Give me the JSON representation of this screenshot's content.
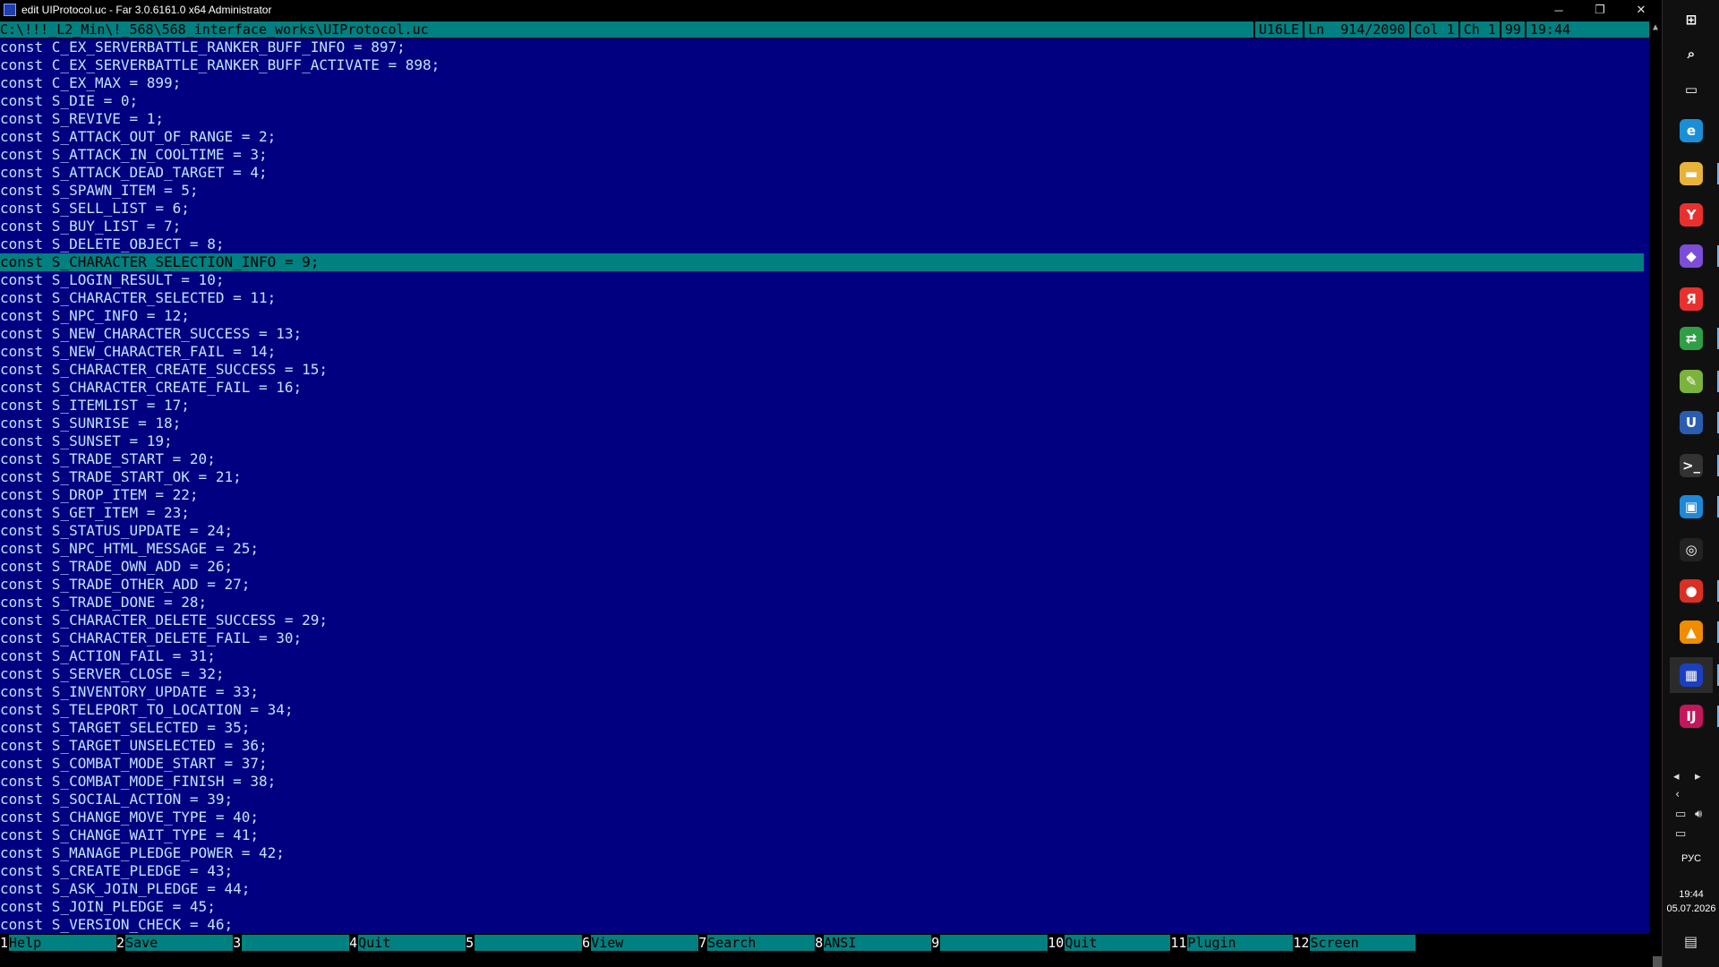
{
  "window": {
    "title": "edit UIProtocol.uc - Far 3.0.6161.0 x64 Administrator",
    "minimize_glyph": "─",
    "restore_glyph": "❐",
    "close_glyph": "✕"
  },
  "status": {
    "path": "C:\\!!!_L2_Min\\!_568\\568_interface_works\\UIProtocol.uc",
    "encoding": "U16LE",
    "line": "Ln  914/2090",
    "col": "Col 1",
    "char": "Ch 1",
    "code": "99",
    "clock": "19:44"
  },
  "editor": {
    "current_line_index": 12,
    "lines": [
      "const C_EX_SERVERBATTLE_RANKER_BUFF_INFO = 897;",
      "const C_EX_SERVERBATTLE_RANKER_BUFF_ACTIVATE = 898;",
      "const C_EX_MAX = 899;",
      "const S_DIE = 0;",
      "const S_REVIVE = 1;",
      "const S_ATTACK_OUT_OF_RANGE = 2;",
      "const S_ATTACK_IN_COOLTIME = 3;",
      "const S_ATTACK_DEAD_TARGET = 4;",
      "const S_SPAWN_ITEM = 5;",
      "const S_SELL_LIST = 6;",
      "const S_BUY_LIST = 7;",
      "const S_DELETE_OBJECT = 8;",
      "const S_CHARACTER_SELECTION_INFO = 9;",
      "const S_LOGIN_RESULT = 10;",
      "const S_CHARACTER_SELECTED = 11;",
      "const S_NPC_INFO = 12;",
      "const S_NEW_CHARACTER_SUCCESS = 13;",
      "const S_NEW_CHARACTER_FAIL = 14;",
      "const S_CHARACTER_CREATE_SUCCESS = 15;",
      "const S_CHARACTER_CREATE_FAIL = 16;",
      "const S_ITEMLIST = 17;",
      "const S_SUNRISE = 18;",
      "const S_SUNSET = 19;",
      "const S_TRADE_START = 20;",
      "const S_TRADE_START_OK = 21;",
      "const S_DROP_ITEM = 22;",
      "const S_GET_ITEM = 23;",
      "const S_STATUS_UPDATE = 24;",
      "const S_NPC_HTML_MESSAGE = 25;",
      "const S_TRADE_OWN_ADD = 26;",
      "const S_TRADE_OTHER_ADD = 27;",
      "const S_TRADE_DONE = 28;",
      "const S_CHARACTER_DELETE_SUCCESS = 29;",
      "const S_CHARACTER_DELETE_FAIL = 30;",
      "const S_ACTION_FAIL = 31;",
      "const S_SERVER_CLOSE = 32;",
      "const S_INVENTORY_UPDATE = 33;",
      "const S_TELEPORT_TO_LOCATION = 34;",
      "const S_TARGET_SELECTED = 35;",
      "const S_TARGET_UNSELECTED = 36;",
      "const S_COMBAT_MODE_START = 37;",
      "const S_COMBAT_MODE_FINISH = 38;",
      "const S_SOCIAL_ACTION = 39;",
      "const S_CHANGE_MOVE_TYPE = 40;",
      "const S_CHANGE_WAIT_TYPE = 41;",
      "const S_MANAGE_PLEDGE_POWER = 42;",
      "const S_CREATE_PLEDGE = 43;",
      "const S_ASK_JOIN_PLEDGE = 44;",
      "const S_JOIN_PLEDGE = 45;",
      "const S_VERSION_CHECK = 46;"
    ]
  },
  "keybar": [
    {
      "num": "1",
      "label": "Help"
    },
    {
      "num": "2",
      "label": "Save"
    },
    {
      "num": "3",
      "label": ""
    },
    {
      "num": "4",
      "label": "Quit"
    },
    {
      "num": "5",
      "label": ""
    },
    {
      "num": "6",
      "label": "View"
    },
    {
      "num": "7",
      "label": "Search"
    },
    {
      "num": "8",
      "label": "ANSI"
    },
    {
      "num": "9",
      "label": ""
    },
    {
      "num": "10",
      "label": "Quit"
    },
    {
      "num": "11",
      "label": "Plugin"
    },
    {
      "num": "12",
      "label": "Screen"
    }
  ],
  "taskbar": {
    "apps": [
      {
        "name": "start-icon",
        "glyph": "⊞",
        "color": "#101010"
      },
      {
        "name": "search-icon",
        "glyph": "⌕",
        "color": "#101010"
      },
      {
        "name": "task-view-icon",
        "glyph": "▭",
        "color": "#101010"
      },
      {
        "name": "edge-icon",
        "glyph": "e",
        "color": "#1b8fd6"
      },
      {
        "name": "file-explorer-icon",
        "glyph": "▬",
        "color": "#e8b339"
      },
      {
        "name": "yandex-browser-icon",
        "glyph": "Y",
        "color": "#e8312f"
      },
      {
        "name": "obsidian-icon",
        "glyph": "◆",
        "color": "#7c4dd6"
      },
      {
        "name": "yandex-icon",
        "glyph": "Я",
        "color": "#e8312f"
      },
      {
        "name": "translator-icon",
        "glyph": "⇄",
        "color": "#2f9e44"
      },
      {
        "name": "notepad-icon",
        "glyph": "✎",
        "color": "#7bb33c"
      },
      {
        "name": "unreal-icon",
        "glyph": "U",
        "color": "#2a5db0"
      },
      {
        "name": "terminal-icon",
        "glyph": ">_",
        "color": "#333333"
      },
      {
        "name": "remote-desktop-icon",
        "glyph": "▣",
        "color": "#1e88d6"
      },
      {
        "name": "steam-icon",
        "glyph": "◎",
        "color": "#222222"
      },
      {
        "name": "chrome-icon",
        "glyph": "●",
        "color": "#d93025"
      },
      {
        "name": "vlc-icon",
        "glyph": "▲",
        "color": "#f08c00"
      },
      {
        "name": "far-manager-icon",
        "glyph": "▦",
        "color": "#1c3fbf"
      },
      {
        "name": "intellij-icon",
        "glyph": "IJ",
        "color": "#c2185b"
      }
    ],
    "active_app_index": 16,
    "tray": {
      "language": "РУС",
      "time": "19:44",
      "date": "05.07.2026"
    }
  }
}
